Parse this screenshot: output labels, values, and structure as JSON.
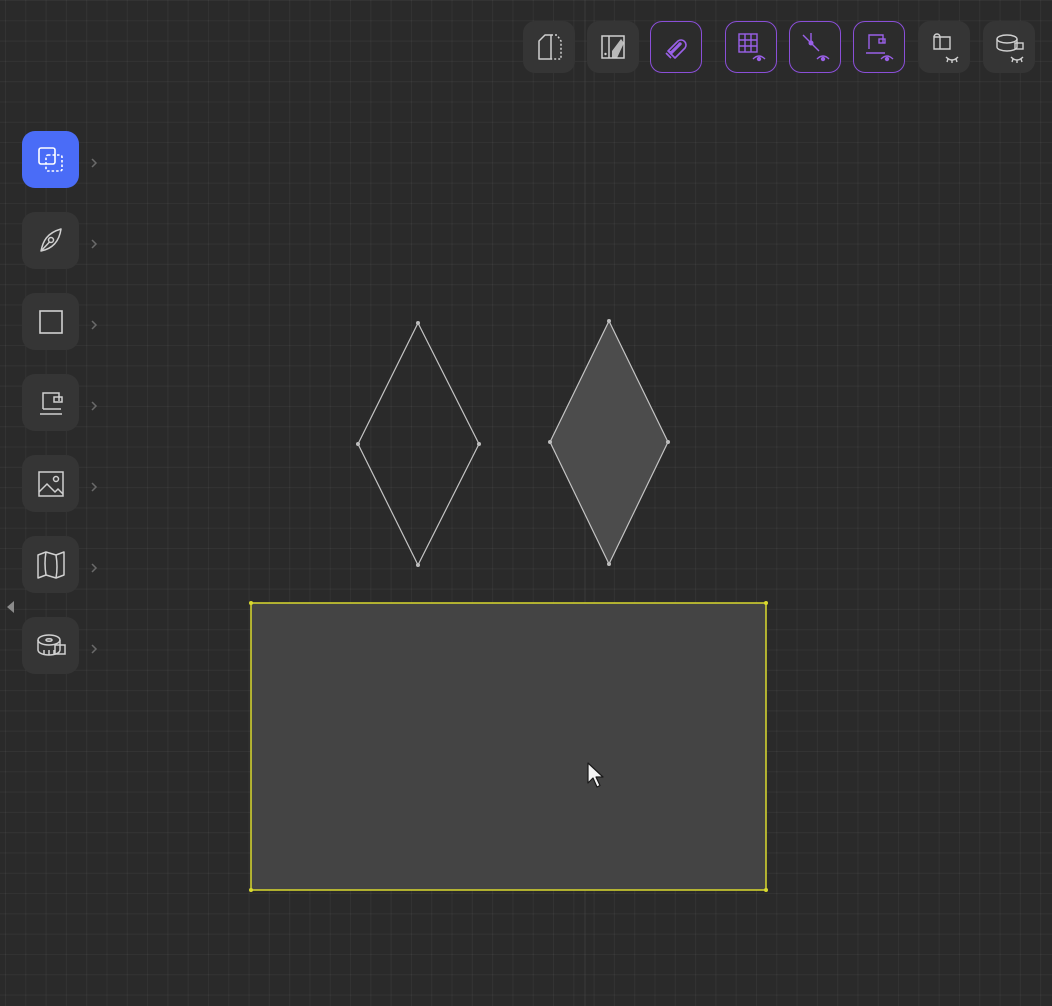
{
  "app": {
    "view": "pattern-drafting-canvas"
  },
  "colors": {
    "canvas_background": "#2a2a2a",
    "grid_line": "#3a3a3a",
    "tool_selected": "#4a6cf7",
    "toggle_active_border": "#8a4fd8",
    "selection_outline": "#d9d92e",
    "shape_stroke": "#bdbdbd",
    "shape_fill": "#4a4a4a"
  },
  "top_toolbar": {
    "buttons": [
      {
        "icon": "pattern-pieces-icon",
        "active": false
      },
      {
        "icon": "fabric-layout-icon",
        "active": false
      },
      {
        "icon": "magnet-snap-icon",
        "active": true
      },
      {
        "icon": "grid-visibility-icon",
        "active": true
      },
      {
        "icon": "point-visibility-icon",
        "active": true
      },
      {
        "icon": "seam-visibility-icon",
        "active": true
      },
      {
        "icon": "fabric-visibility-icon",
        "active": false
      },
      {
        "icon": "measurement-visibility-icon",
        "active": false
      }
    ]
  },
  "left_toolbar": {
    "tools": [
      {
        "icon": "selection-tool-icon",
        "selected": true
      },
      {
        "icon": "pen-tool-icon",
        "selected": false
      },
      {
        "icon": "rectangle-tool-icon",
        "selected": false
      },
      {
        "icon": "sewing-machine-icon",
        "selected": false
      },
      {
        "icon": "image-tool-icon",
        "selected": false
      },
      {
        "icon": "map-tool-icon",
        "selected": false
      },
      {
        "icon": "tape-measure-icon",
        "selected": false
      }
    ]
  },
  "canvas": {
    "shapes": [
      {
        "type": "diamond",
        "filled": false,
        "selected": false
      },
      {
        "type": "diamond",
        "filled": true,
        "selected": false
      },
      {
        "type": "rectangle",
        "filled": true,
        "selected": true
      }
    ]
  }
}
